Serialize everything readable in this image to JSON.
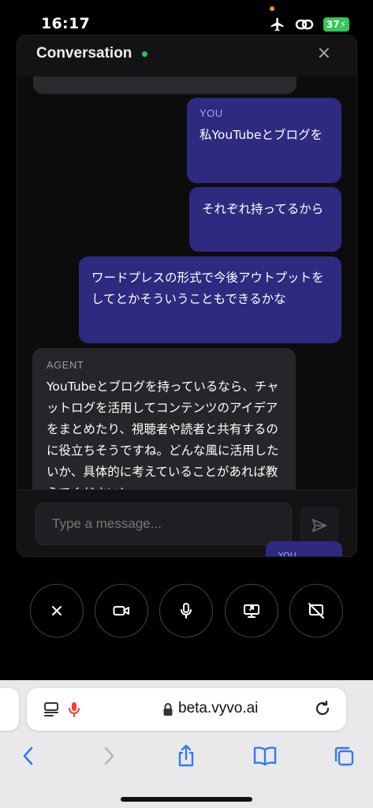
{
  "status_bar": {
    "time": "16:17",
    "battery": "37"
  },
  "panel": {
    "title": "Conversation",
    "close_label": "×",
    "messages": [
      {
        "role": "user",
        "sender": "YOU",
        "text": "私YouTubeとブログを"
      },
      {
        "role": "user",
        "sender": "",
        "text": "それぞれ持ってるから"
      },
      {
        "role": "user",
        "sender": "",
        "text": "ワードプレスの形式で今後アウトプットをしてとかそういうこともできるかな"
      },
      {
        "role": "agent",
        "sender": "AGENT",
        "text": "YouTubeとブログを持っているなら、チャットログを活用してコンテンツのアイデアをまとめたり、視聴者や読者と共有するのに役立ちそうですね。どんな風に活用したいか、具体的に考えていることがあれば教えてください！"
      }
    ],
    "peek_label": "YOU",
    "input_placeholder": "Type a message..."
  },
  "controls": [
    "close-call-icon",
    "camera-icon",
    "microphone-icon",
    "screen-share-icon",
    "screen-share-off-icon"
  ],
  "browser": {
    "url": "beta.vyvo.ai"
  },
  "colors": {
    "user_bubble": "#2d2a80",
    "agent_bubble": "#26262a",
    "online": "#22c55e",
    "safari_blue": "#3478f6"
  }
}
